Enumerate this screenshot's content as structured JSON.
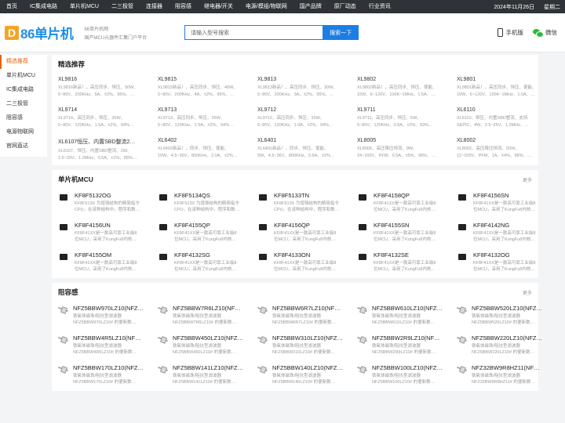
{
  "topnav": {
    "items": [
      "首页",
      "IC集成电路",
      "单片机MCU",
      "二三极管",
      "连接器",
      "阻容感",
      "继电器/开关",
      "电源/模组/物联网",
      "国产品牌",
      "原厂动态",
      "行业资讯"
    ],
    "date": "2024年11月26日",
    "weekday": "星期二"
  },
  "header": {
    "logo_mark": "D",
    "logo_text": "86单片机",
    "site_name": "86单片机网",
    "slogan": "国产MCU元器件汇集门户平台",
    "search_placeholder": "请输入型号搜索",
    "search_button": "搜索一下",
    "phone_label": "手机版",
    "wechat_label": "微信"
  },
  "sidebar": {
    "items": [
      "精选推荐",
      "单片机MCU",
      "IC集成电路",
      "二三极管",
      "阻容感",
      "电源物联网",
      "官网直达"
    ]
  },
  "featured": {
    "title": "精选推荐",
    "items": [
      {
        "name": "XL9816",
        "desc1": "XL9816新品！，高压同步、恒压、50W、",
        "desc2": "5~80V、200KHz、5A、±2%、95%、…"
      },
      {
        "name": "XL9815",
        "desc1": "XL9815新品！，高压同步、恒压、40W、",
        "desc2": "5~80V、200KHz、4A、±2%、95%、…"
      },
      {
        "name": "XL9813",
        "desc1": "XL9813新品！，高压同步、恒压、30W、",
        "desc2": "5~80V、200KHz、3A、±2%、95%、…"
      },
      {
        "name": "XL9802",
        "desc1": "XL9802新品！，高压同步、恒压、使能、",
        "desc2": "15W、6~120V、100K~1MHz、1.5A、…"
      },
      {
        "name": "XL9801",
        "desc1": "XL9801新品！，高压同步、恒压、使能、",
        "desc2": "10W、6~120V、100K~1MHz、1.0A、…"
      },
      {
        "name": "XL9714",
        "desc1": "XL9714、高压同步、恒压、30W、",
        "desc2": "5~80V、120KHz、1.5A、±2%、94%…"
      },
      {
        "name": "XL9713",
        "desc1": "XL9713、高压同步、恒压、25W、",
        "desc2": "5~80V、120KHz、1.5A、±2%、94%…"
      },
      {
        "name": "XL9712",
        "desc1": "XL9712、高压同步、恒压、15W、",
        "desc2": "5~80V、120KHz、1.0A、±2%、94%…"
      },
      {
        "name": "XL9711",
        "desc1": "XL9711、高压同步、恒压、5W、",
        "desc2": "5~80V、120KHz、0.6A、±2%、93%…"
      },
      {
        "name": "XL6110",
        "desc1": "XL6110、恒压、内置SBD整流、支持",
        "desc2": "SEPIC、4W、2.5~25V、1.2MHz、…"
      },
      {
        "name": "XL6107恒压、内置SBD整流2…",
        "desc1": "XL6107、恒压、内置SBD整流、2W、",
        "desc2": "2.5~20V、1.2MHz、0.5A、±2%、85%…"
      },
      {
        "name": "XL6402",
        "desc1": "XL6402新品！，同步、恒压、使能、",
        "desc2": "10W、4.5~36V、800KHz、2.0A、±2%…"
      },
      {
        "name": "XL6401",
        "desc1": "XL6401新品！，同步、恒压、使能、",
        "desc2": "5W、4.5~36V、800KHz、0.6A、±2%…"
      },
      {
        "name": "XL8005",
        "desc1": "XL8005、高压降压恒流、8W、",
        "desc2": "24~100V、PFM、0.5A、±5%、96%、…"
      },
      {
        "name": "XL8002",
        "desc1": "XL8002、高压降压恒流、50W、",
        "desc2": "12~100V、PFM、1A、±4%、98%、…"
      }
    ]
  },
  "mcu": {
    "title": "单片机MCU",
    "more": "更多",
    "items": [
      {
        "name": "KF8F5132OG",
        "desc1": "KF8F513X 为增强结构的精简指令",
        "desc2": "CPU，在该种结构中，程序和数…"
      },
      {
        "name": "KF8F5134QS",
        "desc1": "KF8F513X 为增强结构的精简指令",
        "desc2": "CPU，在该种结构中，程序和数…"
      },
      {
        "name": "KF8F5133TN",
        "desc1": "KF8F513X 为增强结构的精简指令",
        "desc2": "CPU，在该种结构中，程序和数…"
      },
      {
        "name": "KF8F4158QP",
        "desc1": "KF8F41XX是一款高可靠工业级8",
        "desc2": "位MCU，采用了KungFu8内核…"
      },
      {
        "name": "KF8F4156SN",
        "desc1": "KF8F41XX是一款高可靠工业级8",
        "desc2": "位MCU，采用了KungFu8内核…"
      },
      {
        "name": "KF8F4156UN",
        "desc1": "KF8F41XX是一款高可靠工业级8",
        "desc2": "位MCU，采用了KungFu8内核…"
      },
      {
        "name": "KF8F4155QP",
        "desc1": "KF8F41XX是一款高可靠工业级8",
        "desc2": "位MCU，采用了KungFu8内核…"
      },
      {
        "name": "KF8F4156QP",
        "desc1": "KF8F41XX是一款高可靠工业级8",
        "desc2": "位MCU，采用了KungFu8内核…"
      },
      {
        "name": "KF8F4155SN",
        "desc1": "KF8F41XX是一款高可靠工业级8",
        "desc2": "位MCU，采用了KungFu8内核…"
      },
      {
        "name": "KF8F4142NG",
        "desc1": "KF8F41XX是一款高可靠工业级8",
        "desc2": "位MCU，采用了KungFu8内核…"
      },
      {
        "name": "KF8F4155OM",
        "desc1": "KF8F41XX是一款高可靠工业级8",
        "desc2": "位MCU，采用了KungFu8内核…"
      },
      {
        "name": "KF8F4132SG",
        "desc1": "KF8F41XX是一款高可靠工业级8",
        "desc2": "位MCU，采用了KungFu8内核…"
      },
      {
        "name": "KF8F4133ON",
        "desc1": "KF8F41XX是一款高可靠工业级8",
        "desc2": "位MCU，采用了KungFu8内核…"
      },
      {
        "name": "KF8F4132SE",
        "desc1": "KF8F41XX是一款高可靠工业级8",
        "desc2": "位MCU，采用了KungFu8内核…"
      },
      {
        "name": "KF8F4132OG",
        "desc1": "KF8F41XX是一款高可靠工业级8",
        "desc2": "位MCU，采用了KungFu8内核…"
      }
    ]
  },
  "passive": {
    "title": "阻容感",
    "more": "更多",
    "items": [
      {
        "name": "NFZ5BBW970LZ10(NFZ…",
        "desc1": "铁氧体磁珠/阻抗型滤波器",
        "desc2": "NFZ5BBW970LZ10# 的便新数…"
      },
      {
        "name": "NFZ5BBW7R6LZ10(NF…",
        "desc1": "铁氧体磁珠/阻抗型滤波器",
        "desc2": "NFZ5BBW7R6LZ10# 的便新数…"
      },
      {
        "name": "NFZ5BBW6R7LZ10(NF…",
        "desc1": "铁氧体磁珠/阻抗型滤波器",
        "desc2": "NFZ5BBW6R7LZ10# 的便新数…"
      },
      {
        "name": "NFZ5BBW610LZ10(NFZ…",
        "desc1": "铁氧体磁珠/阻抗型滤波器",
        "desc2": "NFZ5BBW610LZ10# 的便新数…"
      },
      {
        "name": "NFZ5BBW520LZ10(NFZ…",
        "desc1": "铁氧体磁珠/阻抗型滤波器",
        "desc2": "NFZ5BBW520LZ10# 的便新数…"
      },
      {
        "name": "NFZ5BBW4R5LZ10(NF…",
        "desc1": "铁氧体磁珠/阻抗型滤波器",
        "desc2": "NFZ5BBW4R5LZ10# 的便新数…"
      },
      {
        "name": "NFZ5BBW450LZ10(NFZ…",
        "desc1": "铁氧体磁珠/阻抗型滤波器",
        "desc2": "NFZ5BBW450LZ10# 的便新数…"
      },
      {
        "name": "NFZ5BBW310LZ10(NFZ…",
        "desc1": "铁氧体磁珠/阻抗型滤波器",
        "desc2": "NFZ5BBW310LZ10# 的便新数…"
      },
      {
        "name": "NFZ5BBW2R9LZ10(NF…",
        "desc1": "铁氧体磁珠/阻抗型滤波器",
        "desc2": "NFZ5BBW2R9LZ10# 的便新数…"
      },
      {
        "name": "NFZ5BBW220LZ10(NFZ…",
        "desc1": "铁氧体磁珠/阻抗型滤波器",
        "desc2": "NFZ5BBW220LZ10# 的便新数…"
      },
      {
        "name": "NFZ5BBW170LZ10(NFZ…",
        "desc1": "铁氧体磁珠/阻抗型滤波器",
        "desc2": "NFZ5BBW170LZ10# 的便新数…"
      },
      {
        "name": "NFZ5BBW141LZ10(NFZ…",
        "desc1": "铁氧体磁珠/阻抗型滤波器",
        "desc2": "NFZ5BBW141LZ10# 的便新数…"
      },
      {
        "name": "NFZ5BBW140LZ10(NFZ…",
        "desc1": "铁氧体磁珠/阻抗型滤波器",
        "desc2": "NFZ5BBW140LZ10# 的便新数…"
      },
      {
        "name": "NFZ5BBW100LZ10(NFZ…",
        "desc1": "铁氧体磁珠/阻抗型滤波器",
        "desc2": "NFZ5BBW100LZ10# 的便新数…"
      },
      {
        "name": "NFZ32BW9R8HZ11(NF…",
        "desc1": "铁氧体磁珠/阻抗型滤波器",
        "desc2": "NFZ32BW9R8HZ11# 的便新数…"
      }
    ]
  }
}
